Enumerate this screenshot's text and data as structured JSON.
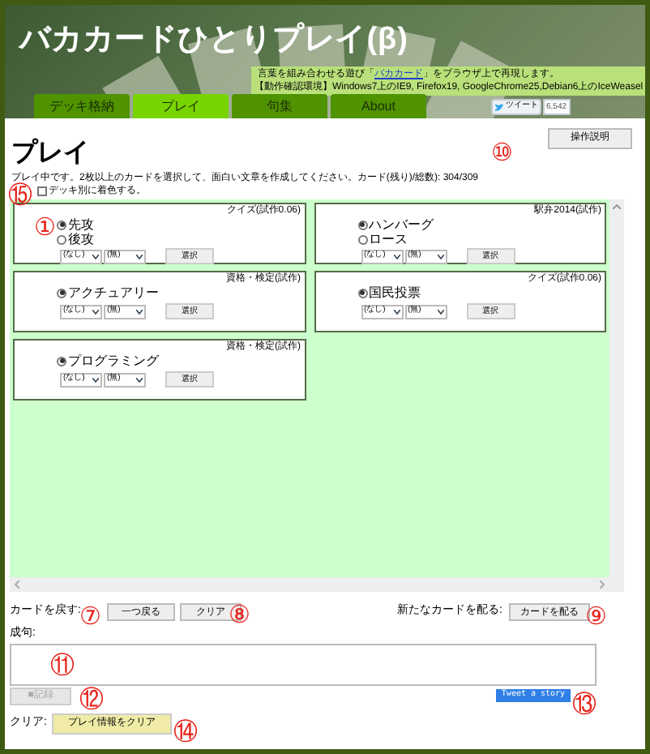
{
  "header": {
    "title": "バカカードひとりプレイ(β)",
    "info_lines": [
      "言葉を組み合わせる遊び「**バカカード**」をブラウザ上で再現します。",
      "【動作確認環境】Windows7上のIE9, Firefox19, GoogleChrome25,Debian6上のIceWeasel"
    ],
    "tabs": [
      {
        "label": "デッキ格納",
        "selected": false
      },
      {
        "label": "プレイ",
        "selected": true
      },
      {
        "label": "句集",
        "selected": false
      },
      {
        "label": "About",
        "selected": false
      }
    ],
    "tweet": {
      "label": "ツイート",
      "count": "6,542"
    }
  },
  "help_button": "操作説明",
  "heading": "プレイ",
  "description": "プレイ中です。2枚以上のカードを選択して、面白い文章を作成してください。カード(残り)/総数): 304/309",
  "color_by_deck": {
    "label": "デッキ別に着色する。",
    "checked": false
  },
  "cards": [
    {
      "source": "クイズ(試作0.06)",
      "options": [
        {
          "label": "先攻",
          "selected": true
        },
        {
          "label": "後攻",
          "selected": false
        }
      ],
      "selects": [
        "(なし)",
        "(無)"
      ],
      "button": "選択"
    },
    {
      "source": "駅弁2014(試作)",
      "options": [
        {
          "label": "ハンバーグ",
          "selected": true
        },
        {
          "label": "ロース",
          "selected": false
        }
      ],
      "selects": [
        "(なし)",
        "(無)"
      ],
      "button": "選択"
    },
    {
      "source": "資格・検定(試作)",
      "options": [
        {
          "label": "アクチュアリー",
          "selected": true
        }
      ],
      "selects": [
        "(なし)",
        "(無)"
      ],
      "button": "選択"
    },
    {
      "source": "クイズ(試作0.06)",
      "options": [
        {
          "label": "国民投票",
          "selected": true
        }
      ],
      "selects": [
        "(なし)",
        "(無)"
      ],
      "button": "選択"
    },
    {
      "source": "資格・検定(試作)",
      "options": [
        {
          "label": "プログラミング",
          "selected": true
        }
      ],
      "selects": [
        "(なし)",
        "(無)"
      ],
      "button": "選択"
    }
  ],
  "return_cards": {
    "label": "カードを戻す:",
    "buttons": [
      "一つ戻る",
      "クリア"
    ]
  },
  "deal": {
    "label": "新たなカードを配る:",
    "button": "カードを配る"
  },
  "phrase": {
    "label": "成句:",
    "record_button": "■記録",
    "record_disabled": true,
    "tweet_button": "Tweet a story"
  },
  "clear": {
    "label": "クリア:",
    "button": "プレイ情報をクリア"
  },
  "annotations": [
    "⑩",
    "⑮",
    "①",
    "⑦",
    "⑧",
    "⑨",
    "⑪",
    "⑫",
    "⑬",
    "⑭"
  ]
}
